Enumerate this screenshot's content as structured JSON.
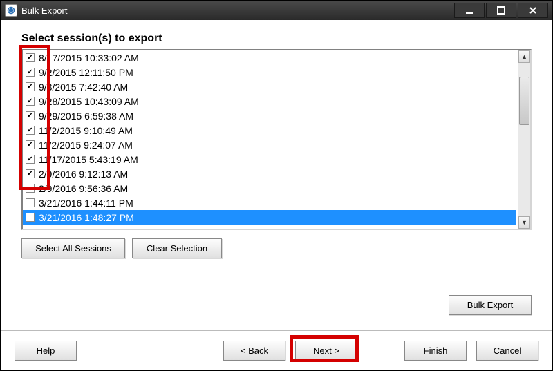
{
  "window": {
    "title": "Bulk Export"
  },
  "prompt": "Select session(s) to export",
  "sessions": [
    {
      "label": "8/17/2015 10:33:02 AM",
      "checked": true,
      "selected": false
    },
    {
      "label": "9/2/2015 12:11:50 PM",
      "checked": true,
      "selected": false
    },
    {
      "label": "9/3/2015 7:42:40 AM",
      "checked": true,
      "selected": false
    },
    {
      "label": "9/28/2015 10:43:09 AM",
      "checked": true,
      "selected": false
    },
    {
      "label": "9/29/2015 6:59:38 AM",
      "checked": true,
      "selected": false
    },
    {
      "label": "11/2/2015 9:10:49 AM",
      "checked": true,
      "selected": false
    },
    {
      "label": "11/2/2015 9:24:07 AM",
      "checked": true,
      "selected": false
    },
    {
      "label": "11/17/2015 5:43:19 AM",
      "checked": true,
      "selected": false
    },
    {
      "label": "2/9/2016 9:12:13 AM",
      "checked": true,
      "selected": false
    },
    {
      "label": "2/9/2016 9:56:36 AM",
      "checked": false,
      "selected": false
    },
    {
      "label": "3/21/2016 1:44:11 PM",
      "checked": false,
      "selected": false
    },
    {
      "label": "3/21/2016 1:48:27 PM",
      "checked": false,
      "selected": true
    }
  ],
  "buttons": {
    "select_all": "Select All Sessions",
    "clear_selection": "Clear Selection",
    "help": "Help",
    "back": "< Back",
    "next": "Next >",
    "finish": "Finish",
    "cancel": "Cancel",
    "bulk_export": "Bulk Export"
  }
}
